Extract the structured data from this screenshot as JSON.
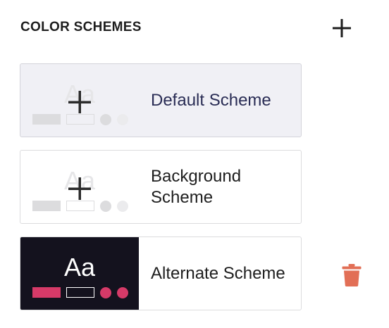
{
  "header": {
    "title": "COLOR SCHEMES",
    "add_icon": "plus-icon"
  },
  "schemes": [
    {
      "label": "Default Scheme",
      "selected": true,
      "preview_text": "Aa",
      "preview_style": "light-placeholder"
    },
    {
      "label": "Background Scheme",
      "selected": false,
      "preview_text": "Aa",
      "preview_style": "light-placeholder"
    },
    {
      "label": "Alternate Scheme",
      "selected": false,
      "preview_text": "Aa",
      "preview_style": "dark",
      "delete_icon": "trash-icon"
    }
  ],
  "colors": {
    "selected_background": "#f0f0f5",
    "dark_preview_background": "#14121e",
    "accent_pink": "#d63a68",
    "delete_red": "#e26f56",
    "selected_label": "#2a2d55"
  }
}
